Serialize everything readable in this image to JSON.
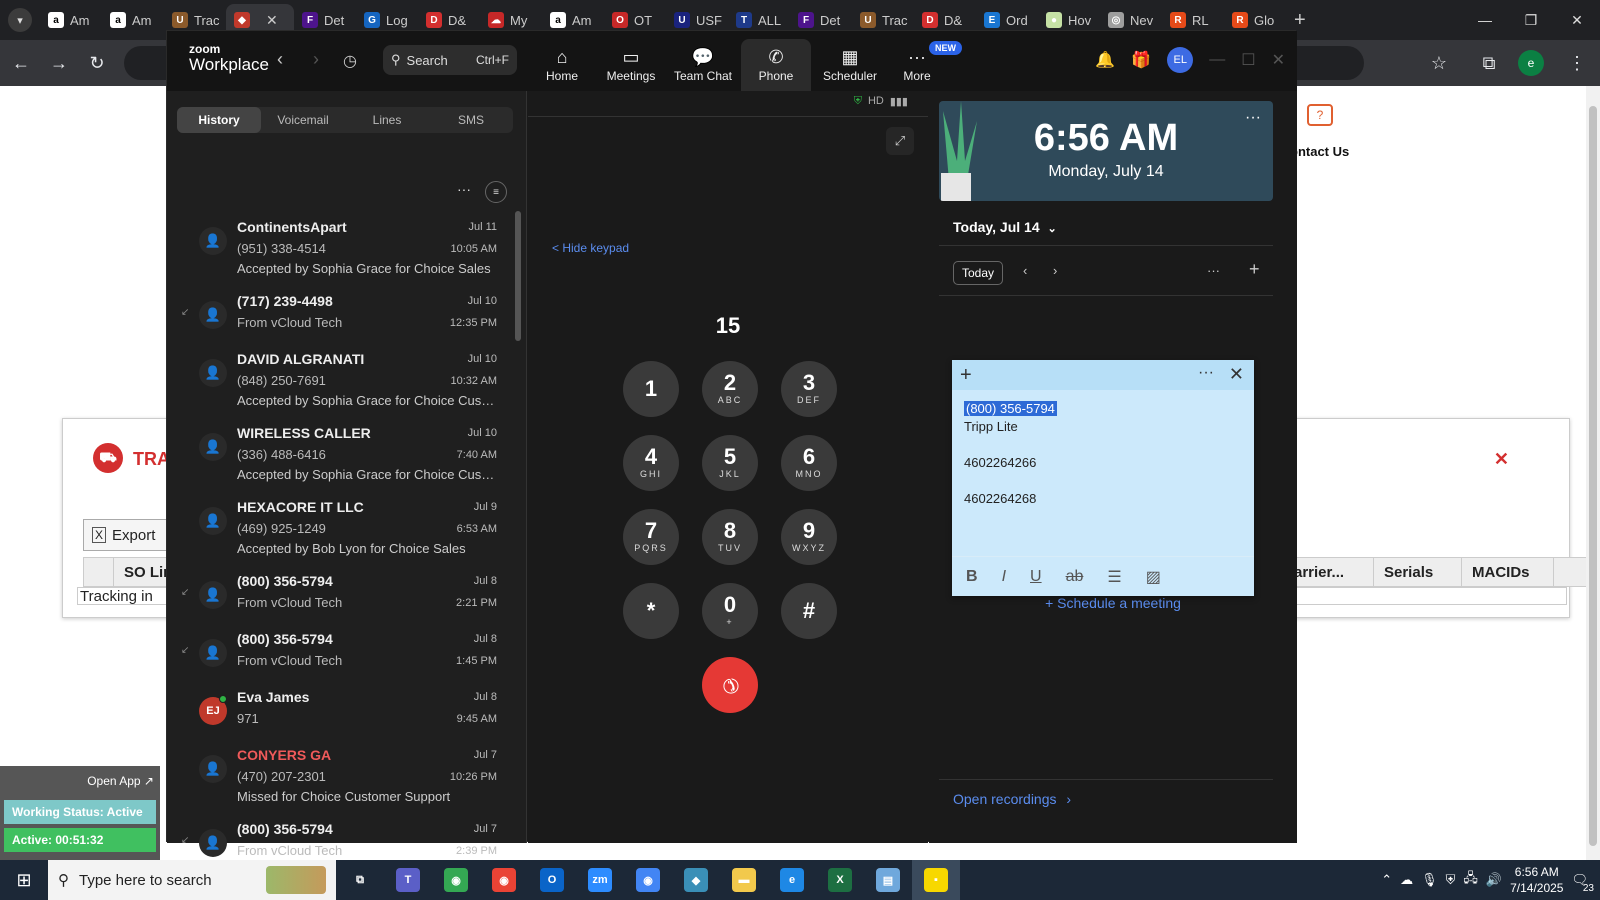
{
  "browser": {
    "tabs": [
      {
        "label": "Am",
        "icon": "amazon-icon",
        "color": "#ffffff",
        "glyph": "a"
      },
      {
        "label": "Am",
        "icon": "amazon-icon",
        "color": "#ffffff",
        "glyph": "a"
      },
      {
        "label": "Trac",
        "icon": "ups-icon",
        "color": "#8b5a2b",
        "glyph": "U"
      },
      {
        "label": "",
        "icon": "app-icon",
        "color": "#c0392b",
        "glyph": "◆",
        "active": true
      },
      {
        "label": "Det",
        "icon": "fedex-icon",
        "color": "#4d148c",
        "glyph": "F"
      },
      {
        "label": "Log",
        "icon": "g-icon",
        "color": "#1565c0",
        "glyph": "G"
      },
      {
        "label": "D&",
        "icon": "dhl-icon",
        "color": "#d32f2f",
        "glyph": "D"
      },
      {
        "label": "My",
        "icon": "cloud-icon",
        "color": "#c62828",
        "glyph": "☁"
      },
      {
        "label": "Am",
        "icon": "amazon-icon",
        "color": "#ffffff",
        "glyph": "a"
      },
      {
        "label": "OT",
        "icon": "ot-icon",
        "color": "#c62828",
        "glyph": "O"
      },
      {
        "label": "USF",
        "icon": "usps-icon",
        "color": "#1a237e",
        "glyph": "U"
      },
      {
        "label": "ALL",
        "icon": "t7-icon",
        "color": "#1e3a8a",
        "glyph": "T"
      },
      {
        "label": "Det",
        "icon": "fedex-icon",
        "color": "#4d148c",
        "glyph": "F"
      },
      {
        "label": "Trac",
        "icon": "ups-icon",
        "color": "#8b5a2b",
        "glyph": "U"
      },
      {
        "label": "D&",
        "icon": "dhl-icon",
        "color": "#d32f2f",
        "glyph": "D"
      },
      {
        "label": "Ord",
        "icon": "ec-icon",
        "color": "#1976d2",
        "glyph": "E"
      },
      {
        "label": "Hov",
        "icon": "circle-icon",
        "color": "#c5e1a5",
        "glyph": "●"
      },
      {
        "label": "Nev",
        "icon": "globe-icon",
        "color": "#9e9e9e",
        "glyph": "◎"
      },
      {
        "label": "RL",
        "icon": "rl-icon",
        "color": "#e64a19",
        "glyph": "R"
      },
      {
        "label": "Glo",
        "icon": "rl-icon",
        "color": "#e64a19",
        "glyph": "R"
      }
    ],
    "profile_initial": "e"
  },
  "webpage": {
    "contact_label": "ontact Us",
    "modal_brand": "TRA",
    "export_label": "Export",
    "columns": [
      "",
      "SO Lin",
      "",
      "",
      "",
      "",
      "",
      "",
      "arrier...",
      "Serials",
      "MACIDs"
    ],
    "row_text": "Tracking in",
    "open_app": "Open App ↗",
    "working_status": "Working Status: Active",
    "active_timer": "Active: 00:51:32"
  },
  "zoom": {
    "logo_top": "zoom",
    "logo_bottom": "Workplace",
    "search_label": "Search",
    "search_shortcut": "Ctrl+F",
    "nav": [
      {
        "label": "Home",
        "icon": "home-icon"
      },
      {
        "label": "Meetings",
        "icon": "video-icon"
      },
      {
        "label": "Team Chat",
        "icon": "chat-icon"
      },
      {
        "label": "Phone",
        "icon": "phone-icon",
        "active": true
      },
      {
        "label": "Scheduler",
        "icon": "calendar-icon"
      },
      {
        "label": "More",
        "icon": "more-icon"
      }
    ],
    "new_badge": "NEW",
    "avatar_initials": "EL",
    "tabs": [
      "History",
      "Voicemail",
      "Lines",
      "SMS"
    ],
    "calls": [
      {
        "name": "ContinentsApart",
        "date": "Jul 11",
        "number": "(951) 338-4514",
        "time": "10:05 AM",
        "note": "Accepted by Sophia Grace for Choice Sales"
      },
      {
        "name": "(717) 239-4498",
        "date": "Jul 10",
        "number": "From vCloud Tech",
        "time": "12:35 PM",
        "incoming": true
      },
      {
        "name": "DAVID ALGRANATI",
        "date": "Jul 10",
        "number": "(848) 250-7691",
        "time": "10:32 AM",
        "note": "Accepted by Sophia Grace for Choice Custo..."
      },
      {
        "name": "WIRELESS CALLER",
        "date": "Jul 10",
        "number": "(336) 488-6416",
        "time": "7:40 AM",
        "note": "Accepted by Sophia Grace for Choice Custo..."
      },
      {
        "name": "HEXACORE IT LLC",
        "date": "Jul 9",
        "number": "(469) 925-1249",
        "time": "6:53 AM",
        "note": "Accepted by Bob Lyon for Choice Sales"
      },
      {
        "name": "(800) 356-5794",
        "date": "Jul 8",
        "number": "From vCloud Tech",
        "time": "2:21 PM",
        "incoming": true
      },
      {
        "name": "(800) 356-5794",
        "date": "Jul 8",
        "number": "From vCloud Tech",
        "time": "1:45 PM",
        "incoming": true
      },
      {
        "name": "Eva James",
        "date": "Jul 8",
        "number": "971",
        "time": "9:45 AM",
        "avatar": "EJ"
      },
      {
        "name": "CONYERS GA",
        "date": "Jul 7",
        "number": "(470) 207-2301",
        "time": "10:26 PM",
        "note": "Missed for Choice Customer Support",
        "missed": true
      },
      {
        "name": "(800) 356-5794",
        "date": "Jul 7",
        "number": "From vCloud Tech",
        "time": "2:39 PM",
        "incoming": true
      }
    ],
    "dialer": {
      "hide_keypad": "< Hide keypad",
      "dialed": "15",
      "keys": [
        {
          "d": "1",
          "l": ""
        },
        {
          "d": "2",
          "l": "ABC"
        },
        {
          "d": "3",
          "l": "DEF"
        },
        {
          "d": "4",
          "l": "GHI"
        },
        {
          "d": "5",
          "l": "JKL"
        },
        {
          "d": "6",
          "l": "MNO"
        },
        {
          "d": "7",
          "l": "PQRS"
        },
        {
          "d": "8",
          "l": "TUV"
        },
        {
          "d": "9",
          "l": "WXYZ"
        },
        {
          "d": "*",
          "l": ""
        },
        {
          "d": "0",
          "l": "+"
        },
        {
          "d": "#",
          "l": ""
        }
      ]
    },
    "calendar": {
      "time": "6:56 AM",
      "date": "Monday, July 14",
      "day_heading": "Today, Jul 14",
      "today_btn": "Today",
      "schedule_link": "Schedule a meeting",
      "open_recordings": "Open recordings"
    }
  },
  "sticky": {
    "line1": "(800) 356-5794",
    "line2": "Tripp Lite",
    "line3": "4602264266",
    "line4": "4602264268"
  },
  "taskbar": {
    "search_placeholder": "Type here to search",
    "time": "6:56 AM",
    "date": "7/14/2025",
    "notif_count": "23",
    "apps": [
      {
        "icon": "task-view-icon",
        "color": "#1c2837",
        "glyph": "⧉"
      },
      {
        "icon": "teams-icon",
        "color": "#5b5fc7",
        "glyph": "T"
      },
      {
        "icon": "chrome-icon",
        "color": "#34a853",
        "glyph": "◉"
      },
      {
        "icon": "chrome-icon",
        "color": "#ea4335",
        "glyph": "◉"
      },
      {
        "icon": "outlook-icon",
        "color": "#0a64c8",
        "glyph": "O"
      },
      {
        "icon": "zoom-icon",
        "color": "#2d8cff",
        "glyph": "zm"
      },
      {
        "icon": "chrome-icon",
        "color": "#4285f4",
        "glyph": "◉"
      },
      {
        "icon": "app-icon",
        "color": "#3a8fb7",
        "glyph": "◆"
      },
      {
        "icon": "folder-icon",
        "color": "#f2c94c",
        "glyph": "▬"
      },
      {
        "icon": "edge-icon",
        "color": "#1e88e5",
        "glyph": "e"
      },
      {
        "icon": "excel-icon",
        "color": "#1d6f42",
        "glyph": "X"
      },
      {
        "icon": "map-icon",
        "color": "#6fa8dc",
        "glyph": "▤"
      },
      {
        "icon": "sticky-notes-icon",
        "color": "#f7d800",
        "glyph": "▪"
      }
    ]
  }
}
